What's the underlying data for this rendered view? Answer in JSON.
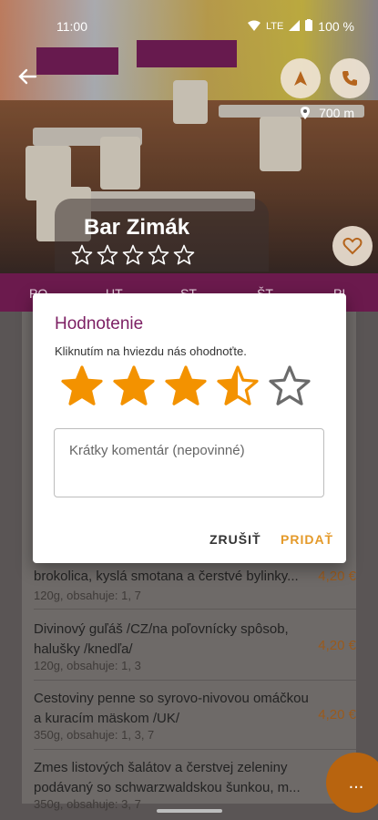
{
  "status": {
    "time": "11:00",
    "network": "LTE",
    "battery": "100 %"
  },
  "header": {
    "restaurant_name": "Bar Zimák",
    "distance": "700 m",
    "star_count": 5
  },
  "days": [
    "PO",
    "UT",
    "ST",
    "ŠT",
    "PI"
  ],
  "dialog": {
    "title": "Hodnotenie",
    "subtitle": "Kliknutím na hviezdu nás ohodnoťte.",
    "rating": 3.5,
    "max_rating": 5,
    "comment_placeholder": "Krátky komentár (nepovinné)",
    "cancel_label": "ZRUŠIŤ",
    "add_label": "PRIDAŤ"
  },
  "menu_items": [
    {
      "name": "brokolica, kyslá smotana a čerstvé bylinky...",
      "meta": "120g, obsahuje: 1, 7",
      "price": "4,20 €"
    },
    {
      "name": "Divinový guľáš /CZ/na poľovnícky spôsob, halušky /knedľa/",
      "meta": "120g, obsahuje: 1, 3",
      "price": "4,20 €"
    },
    {
      "name": "Cestoviny penne so syrovo-nivovou omáčkou a kuracím mäskom /UK/",
      "meta": "350g, obsahuje: 1, 3, 7",
      "price": "4,20 €"
    },
    {
      "name": "Zmes listových šalátov a čerstvej zeleniny podávaný so schwarzwaldskou šunkou, m...",
      "meta": "350g, obsahuje: 3, 7",
      "price": ""
    }
  ],
  "fab_label": "...",
  "colors": {
    "primary": "#7c1f63",
    "accent": "#e49a2a",
    "star": "#f39200"
  }
}
